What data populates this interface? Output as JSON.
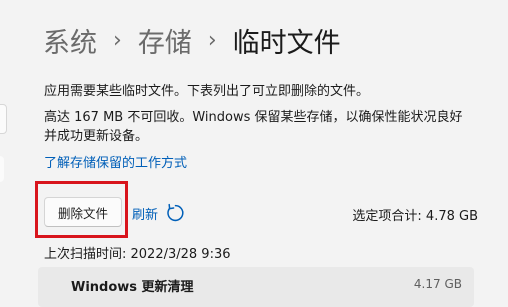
{
  "breadcrumb": {
    "items": [
      "系统",
      "存储"
    ],
    "separator": "›",
    "current": "临时文件"
  },
  "description": {
    "line1": "应用需要某些临时文件。下表列出了可立即删除的文件。",
    "line2": "高达 167 MB 不可回收。Windows 保留某些存储，以确保性能状况良好并成功更新设备。"
  },
  "links": {
    "learn_more": "了解存储保留的工作方式"
  },
  "actions": {
    "delete_label": "删除文件",
    "refresh_label": "刷新",
    "refresh_icon": "refresh-icon"
  },
  "summary": {
    "selected_total": "选定项合计: 4.78 GB",
    "last_scan": "上次扫描时间: 2022/3/28 9:36"
  },
  "list": {
    "items": [
      {
        "name": "Windows 更新清理",
        "size": "4.17 GB"
      }
    ]
  },
  "colors": {
    "accent": "#005fb8",
    "highlight": "#d8141c",
    "background": "#f3f3f3"
  }
}
